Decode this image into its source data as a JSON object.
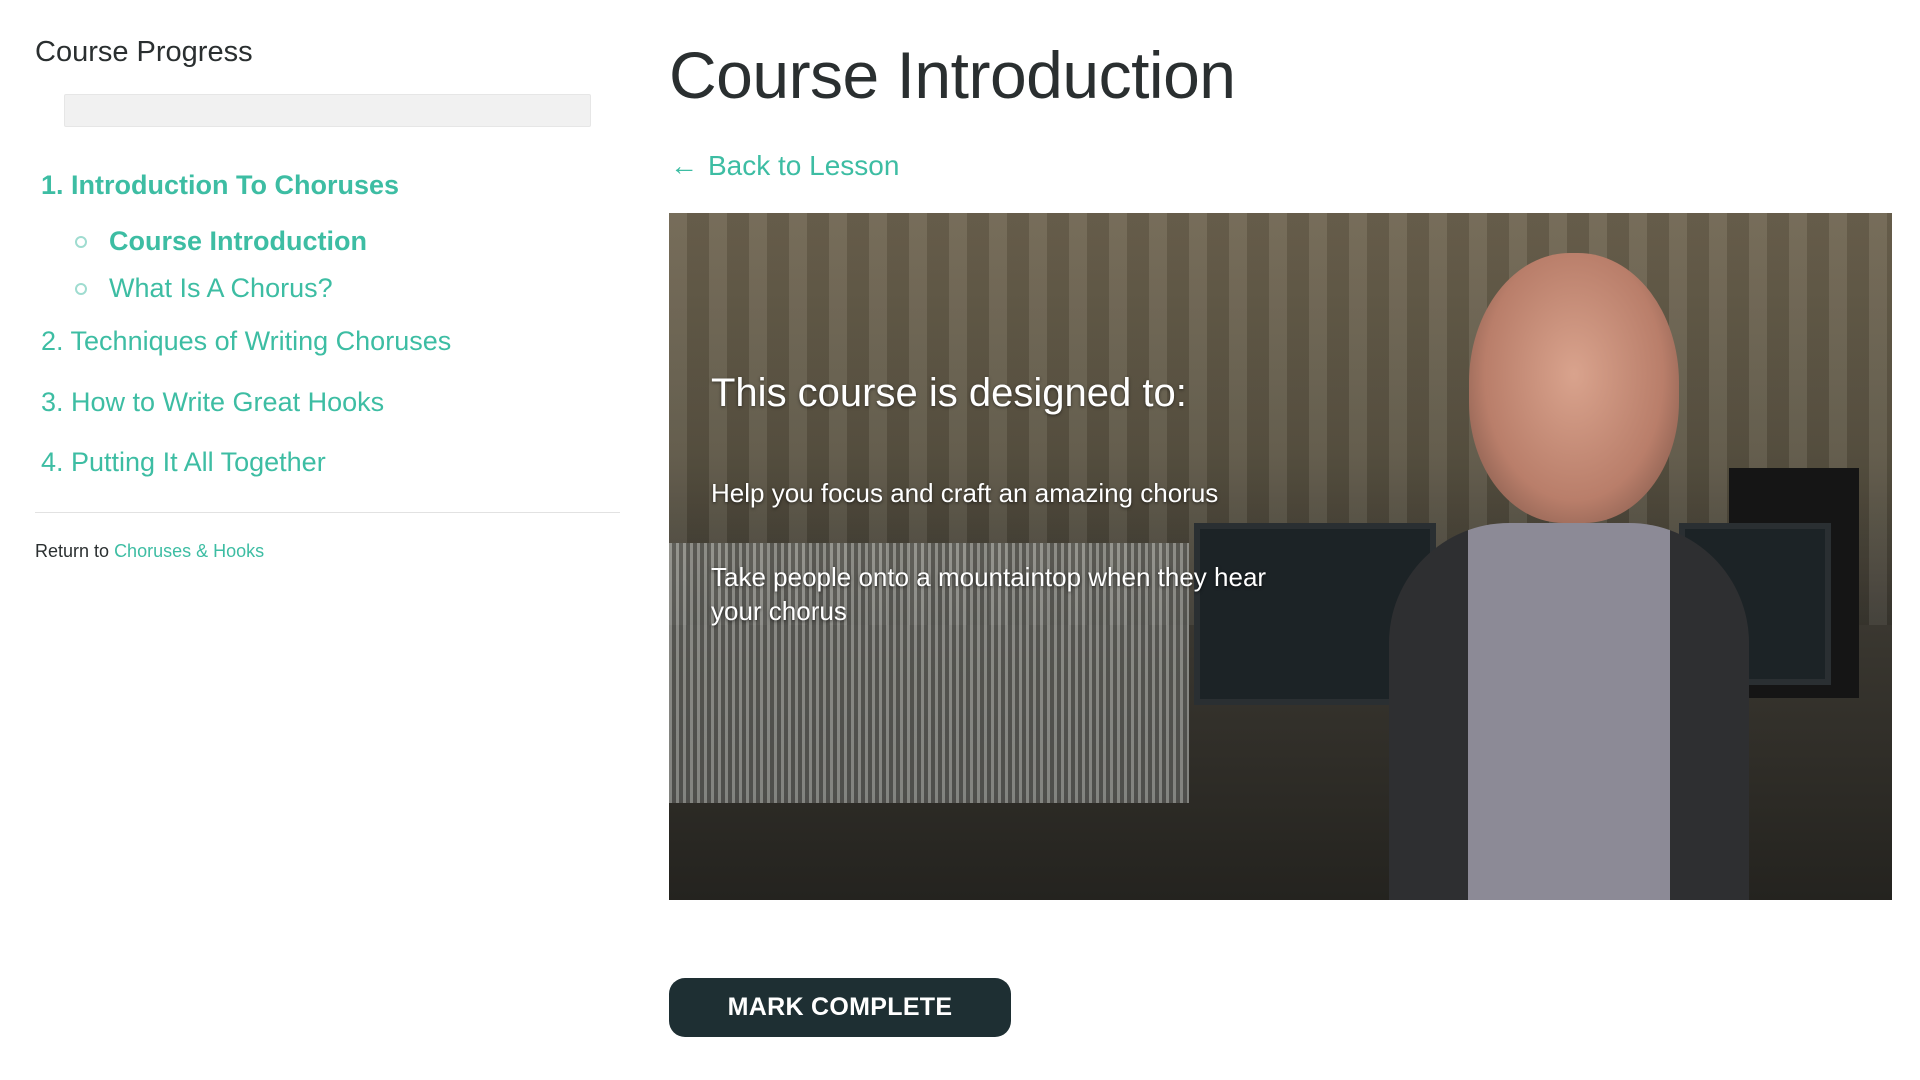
{
  "sidebar": {
    "title": "Course Progress",
    "progress": 0,
    "sections": [
      {
        "label": "1. Introduction To Choruses",
        "lessons": [
          {
            "label": "Course Introduction"
          },
          {
            "label": "What Is A Chorus?"
          }
        ]
      },
      {
        "label": "2. Techniques of Writing Choruses"
      },
      {
        "label": "3. How to Write Great Hooks"
      },
      {
        "label": "4. Putting It All Together"
      }
    ],
    "return_prefix": "Return to",
    "return_link": "Choruses & Hooks"
  },
  "main": {
    "title": "Course Introduction",
    "back_label": "Back to Lesson",
    "video": {
      "heading": "This course is designed to:",
      "points": [
        "Help you focus and craft an amazing chorus",
        "Take people onto a mountaintop when they hear your chorus"
      ]
    },
    "mark_complete": "MARK COMPLETE"
  },
  "icons": {
    "back": "arrow-left-icon",
    "lesson": "circle-outline-icon"
  },
  "colors": {
    "accent": "#3dbda3",
    "button": "#1e2f33"
  }
}
